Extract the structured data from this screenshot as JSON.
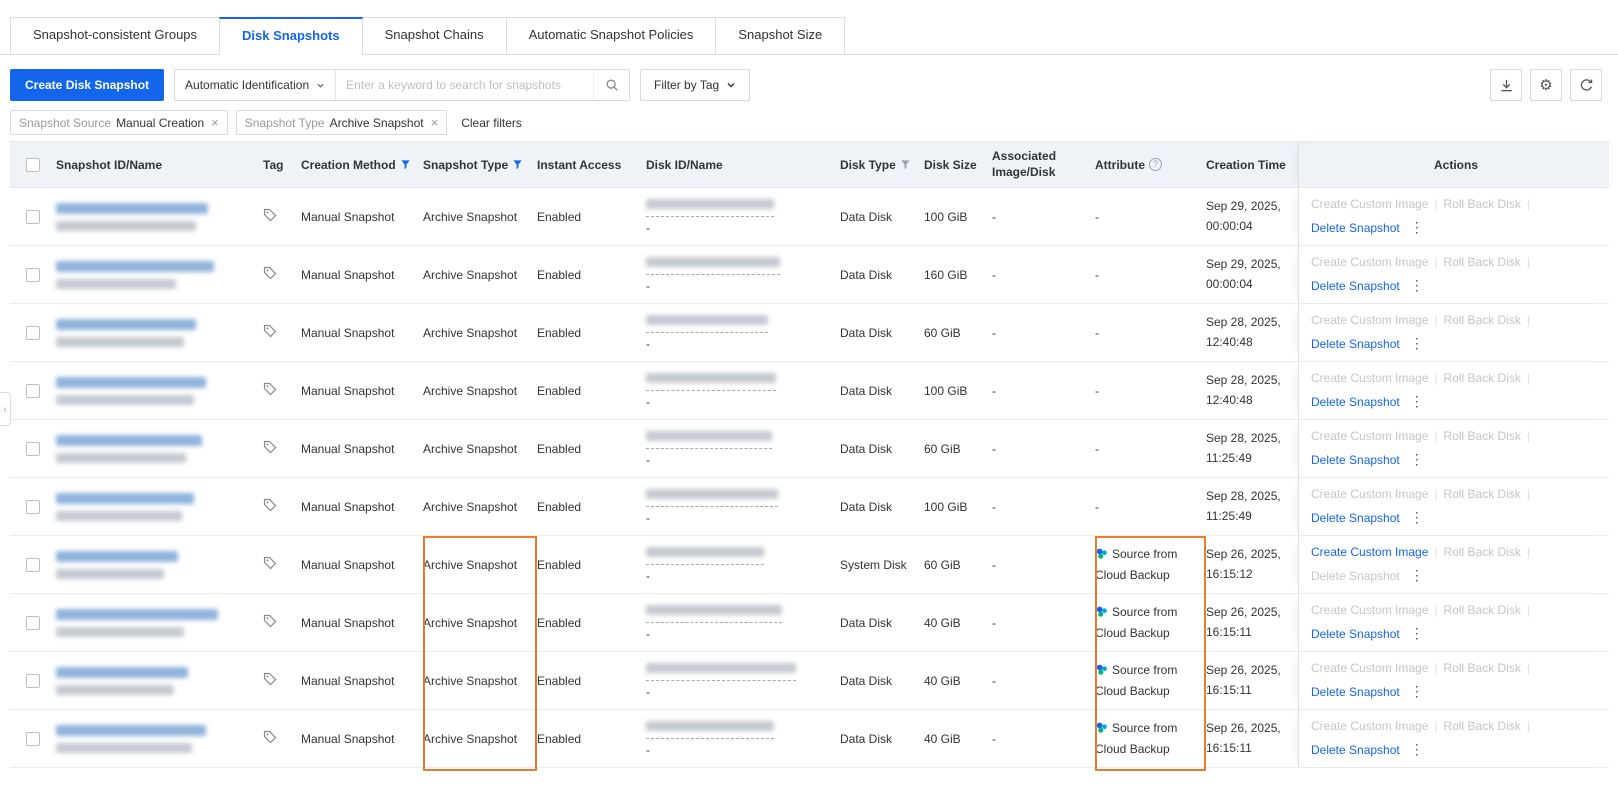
{
  "page": {
    "tabs": [
      {
        "label": "Snapshot-consistent Groups"
      },
      {
        "label": "Disk Snapshots"
      },
      {
        "label": "Snapshot Chains"
      },
      {
        "label": "Automatic Snapshot Policies"
      },
      {
        "label": "Snapshot Size"
      }
    ],
    "active_tab": "Disk Snapshots"
  },
  "toolbar": {
    "create_button_label": "Create Disk Snapshot",
    "search_mode_label": "Automatic Identification",
    "search_placeholder": "Enter a keyword to search for snapshots",
    "filter_by_tag_label": "Filter by Tag"
  },
  "filter_chips": [
    {
      "name": "Snapshot Source",
      "value": "Manual Creation"
    },
    {
      "name": "Snapshot Type",
      "value": "Archive Snapshot"
    }
  ],
  "clear_filters_label": "Clear filters",
  "row_actions": {
    "create_custom_image": "Create Custom Image",
    "roll_back_disk": "Roll Back Disk",
    "delete_snapshot": "Delete Snapshot"
  },
  "table": {
    "dash": "-",
    "headers": {
      "snapshot_id": "Snapshot ID/Name",
      "tag": "Tag",
      "creation_method": "Creation Method",
      "snapshot_type": "Snapshot Type",
      "instant_access": "Instant Access",
      "disk_id": "Disk ID/Name",
      "disk_type": "Disk Type",
      "disk_size": "Disk Size",
      "associated": "Associated Image/Disk",
      "attribute": "Attribute",
      "creation_time": "Creation Time",
      "actions": "Actions"
    },
    "rows": [
      {
        "creation_method": "Manual Snapshot",
        "snapshot_type": "Archive Snapshot",
        "instant_access": "Enabled",
        "disk_type": "Data Disk",
        "disk_size": "100 GiB",
        "associated_image_disk": "-",
        "attribute": "-",
        "creation_date": "Sep 29, 2025,",
        "creation_time": "00:00:04",
        "actions": {
          "create_custom_image": false,
          "roll_back_disk": false,
          "delete_snapshot": true
        }
      },
      {
        "creation_method": "Manual Snapshot",
        "snapshot_type": "Archive Snapshot",
        "instant_access": "Enabled",
        "disk_type": "Data Disk",
        "disk_size": "160 GiB",
        "associated_image_disk": "-",
        "attribute": "-",
        "creation_date": "Sep 29, 2025,",
        "creation_time": "00:00:04",
        "actions": {
          "create_custom_image": false,
          "roll_back_disk": false,
          "delete_snapshot": true
        }
      },
      {
        "creation_method": "Manual Snapshot",
        "snapshot_type": "Archive Snapshot",
        "instant_access": "Enabled",
        "disk_type": "Data Disk",
        "disk_size": "60 GiB",
        "associated_image_disk": "-",
        "attribute": "-",
        "creation_date": "Sep 28, 2025,",
        "creation_time": "12:40:48",
        "actions": {
          "create_custom_image": false,
          "roll_back_disk": false,
          "delete_snapshot": true
        }
      },
      {
        "creation_method": "Manual Snapshot",
        "snapshot_type": "Archive Snapshot",
        "instant_access": "Enabled",
        "disk_type": "Data Disk",
        "disk_size": "100 GiB",
        "associated_image_disk": "-",
        "attribute": "-",
        "creation_date": "Sep 28, 2025,",
        "creation_time": "12:40:48",
        "actions": {
          "create_custom_image": false,
          "roll_back_disk": false,
          "delete_snapshot": true
        }
      },
      {
        "creation_method": "Manual Snapshot",
        "snapshot_type": "Archive Snapshot",
        "instant_access": "Enabled",
        "disk_type": "Data Disk",
        "disk_size": "60 GiB",
        "associated_image_disk": "-",
        "attribute": "-",
        "creation_date": "Sep 28, 2025,",
        "creation_time": "11:25:49",
        "actions": {
          "create_custom_image": false,
          "roll_back_disk": false,
          "delete_snapshot": true
        }
      },
      {
        "creation_method": "Manual Snapshot",
        "snapshot_type": "Archive Snapshot",
        "instant_access": "Enabled",
        "disk_type": "Data Disk",
        "disk_size": "100 GiB",
        "associated_image_disk": "-",
        "attribute": "-",
        "creation_date": "Sep 28, 2025,",
        "creation_time": "11:25:49",
        "actions": {
          "create_custom_image": false,
          "roll_back_disk": false,
          "delete_snapshot": true
        }
      },
      {
        "creation_method": "Manual Snapshot",
        "snapshot_type": "Archive Snapshot",
        "instant_access": "Enabled",
        "disk_type": "System Disk",
        "disk_size": "60 GiB",
        "associated_image_disk": "-",
        "attribute": "Source from Cloud Backup",
        "creation_date": "Sep 26, 2025,",
        "creation_time": "16:15:12",
        "actions": {
          "create_custom_image": true,
          "roll_back_disk": false,
          "delete_snapshot": false
        }
      },
      {
        "creation_method": "Manual Snapshot",
        "snapshot_type": "Archive Snapshot",
        "instant_access": "Enabled",
        "disk_type": "Data Disk",
        "disk_size": "40 GiB",
        "associated_image_disk": "-",
        "attribute": "Source from Cloud Backup",
        "creation_date": "Sep 26, 2025,",
        "creation_time": "16:15:11",
        "actions": {
          "create_custom_image": false,
          "roll_back_disk": false,
          "delete_snapshot": true
        }
      },
      {
        "creation_method": "Manual Snapshot",
        "snapshot_type": "Archive Snapshot",
        "instant_access": "Enabled",
        "disk_type": "Data Disk",
        "disk_size": "40 GiB",
        "associated_image_disk": "-",
        "attribute": "Source from Cloud Backup",
        "creation_date": "Sep 26, 2025,",
        "creation_time": "16:15:11",
        "actions": {
          "create_custom_image": false,
          "roll_back_disk": false,
          "delete_snapshot": true
        }
      },
      {
        "creation_method": "Manual Snapshot",
        "snapshot_type": "Archive Snapshot",
        "instant_access": "Enabled",
        "disk_type": "Data Disk",
        "disk_size": "40 GiB",
        "associated_image_disk": "-",
        "attribute": "Source from Cloud Backup",
        "creation_date": "Sep 26, 2025,",
        "creation_time": "16:15:11",
        "actions": {
          "create_custom_image": false,
          "roll_back_disk": false,
          "delete_snapshot": true
        }
      }
    ]
  },
  "colors": {
    "accent_blue": "#1366EC",
    "highlight_orange": "#ED7B2F",
    "table_header_bg": "#EFF3F8"
  }
}
